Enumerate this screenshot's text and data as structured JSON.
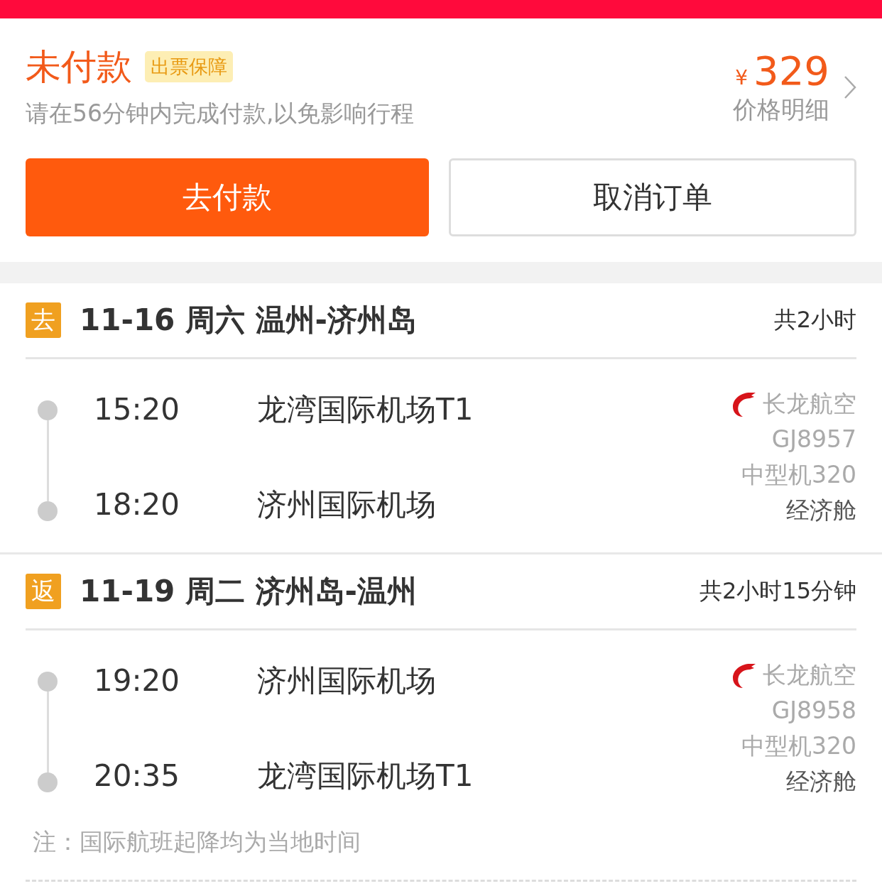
{
  "order": {
    "status": "未付款",
    "badge": "出票保障",
    "notice": "请在56分钟内完成付款,以免影响行程",
    "currency": "¥",
    "price": "329",
    "price_link": "价格明细"
  },
  "buttons": [
    {
      "kind": "primary",
      "label": "去付款"
    },
    {
      "kind": "secondary",
      "label": "取消订单"
    }
  ],
  "segments": [
    {
      "tag": "去",
      "title": "11-16 周六 温州-济州岛",
      "duration": "共2小时",
      "depart_time": "15:20",
      "depart_airport": "龙湾国际机场T1",
      "arrive_time": "18:20",
      "arrive_airport": "济州国际机场",
      "airline": "长龙航空",
      "flight_no": "GJ8957",
      "aircraft": "中型机320",
      "cabin": "经济舱"
    },
    {
      "tag": "返",
      "title": "11-19 周二 济州岛-温州",
      "duration": "共2小时15分钟",
      "depart_time": "19:20",
      "depart_airport": "济州国际机场",
      "arrive_time": "20:35",
      "arrive_airport": "龙湾国际机场T1",
      "airline": "长龙航空",
      "flight_no": "GJ8958",
      "aircraft": "中型机320",
      "cabin": "经济舱"
    }
  ],
  "note": "注：国际航班起降均为当地时间"
}
